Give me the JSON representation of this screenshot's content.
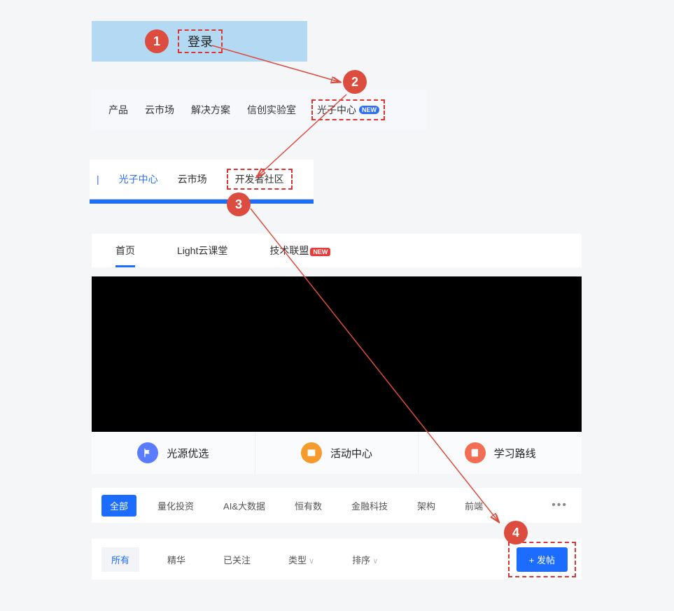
{
  "login": {
    "label": "登录"
  },
  "nav1": {
    "items": [
      "产品",
      "云市场",
      "解决方案",
      "信创实验室"
    ],
    "photon": "光子中心",
    "new": "NEW"
  },
  "nav2": {
    "photon": "光子中心",
    "market": "云市场",
    "dev": "开发者社区"
  },
  "tabs": {
    "home": "首页",
    "cloud": "Light云课堂",
    "alliance": "技术联盟",
    "new": "NEW"
  },
  "iconrow": {
    "a": "光源优选",
    "b": "活动中心",
    "c": "学习路线"
  },
  "filters": {
    "all": "全部",
    "items": [
      "量化投资",
      "AI&大数据",
      "恒有数",
      "金融科技",
      "架构",
      "前端"
    ]
  },
  "filters2": {
    "all": "所有",
    "essence": "精华",
    "followed": "已关注",
    "type": "类型",
    "sort": "排序",
    "post": "+ 发帖"
  },
  "steps": {
    "s1": "1",
    "s2": "2",
    "s3": "3",
    "s4": "4"
  }
}
